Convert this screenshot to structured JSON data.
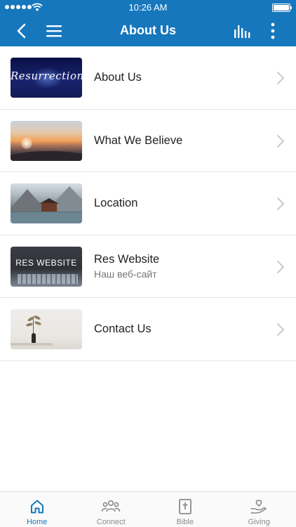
{
  "status_bar": {
    "time": "10:26 AM",
    "signal_bars": 5,
    "battery_level": 1.0
  },
  "header": {
    "title": "About Us",
    "background_color": "#1677bd",
    "left_icons": [
      "back-chevron-icon",
      "hamburger-menu-icon"
    ],
    "right_icons": [
      "audio-bars-icon",
      "more-vertical-icon"
    ]
  },
  "list": {
    "items": [
      {
        "title": "About Us",
        "subtitle": "",
        "thumbnail": "resurrection-banner",
        "thumbnail_text": "Resurrection"
      },
      {
        "title": "What We Believe",
        "subtitle": "",
        "thumbnail": "sunset-photo"
      },
      {
        "title": "Location",
        "subtitle": "",
        "thumbnail": "lake-house-photo"
      },
      {
        "title": "Res Website",
        "subtitle": "Наш веб-сайт",
        "thumbnail": "website-banner",
        "thumbnail_text": "RES WEBSITE"
      },
      {
        "title": "Contact Us",
        "subtitle": "",
        "thumbnail": "vase-photo"
      }
    ]
  },
  "tabbar": {
    "active_color": "#1677bd",
    "tabs": [
      {
        "label": "Home",
        "icon": "home-icon",
        "active": true
      },
      {
        "label": "Connect",
        "icon": "people-icon",
        "active": false
      },
      {
        "label": "Bible",
        "icon": "bible-icon",
        "active": false
      },
      {
        "label": "Giving",
        "icon": "giving-hand-heart-icon",
        "active": false
      }
    ]
  }
}
